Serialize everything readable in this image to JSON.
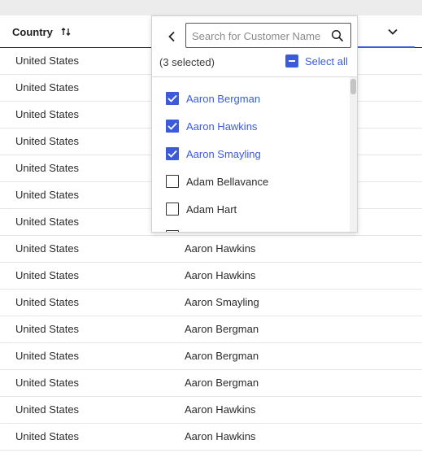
{
  "header": {
    "country_label": "Country"
  },
  "filter": {
    "search_placeholder": "Search for Customer Name",
    "selected_count": "(3 selected)",
    "select_all_label": "Select all",
    "options": [
      {
        "label": "Aaron Bergman",
        "checked": true
      },
      {
        "label": "Aaron Hawkins",
        "checked": true
      },
      {
        "label": "Aaron Smayling",
        "checked": true
      },
      {
        "label": "Adam Bellavance",
        "checked": false
      },
      {
        "label": "Adam Hart",
        "checked": false
      },
      {
        "label": "",
        "checked": false
      }
    ]
  },
  "rows": [
    {
      "country": "United States",
      "customer": ""
    },
    {
      "country": "United States",
      "customer": ""
    },
    {
      "country": "United States",
      "customer": ""
    },
    {
      "country": "United States",
      "customer": ""
    },
    {
      "country": "United States",
      "customer": ""
    },
    {
      "country": "United States",
      "customer": ""
    },
    {
      "country": "United States",
      "customer": ""
    },
    {
      "country": "United States",
      "customer": "Aaron Hawkins"
    },
    {
      "country": "United States",
      "customer": "Aaron Hawkins"
    },
    {
      "country": "United States",
      "customer": "Aaron Smayling"
    },
    {
      "country": "United States",
      "customer": "Aaron Bergman"
    },
    {
      "country": "United States",
      "customer": "Aaron Bergman"
    },
    {
      "country": "United States",
      "customer": "Aaron Bergman"
    },
    {
      "country": "United States",
      "customer": "Aaron Hawkins"
    },
    {
      "country": "United States",
      "customer": "Aaron Hawkins"
    }
  ],
  "colors": {
    "accent": "#3b5bdb",
    "header_strip": "#ececec"
  }
}
